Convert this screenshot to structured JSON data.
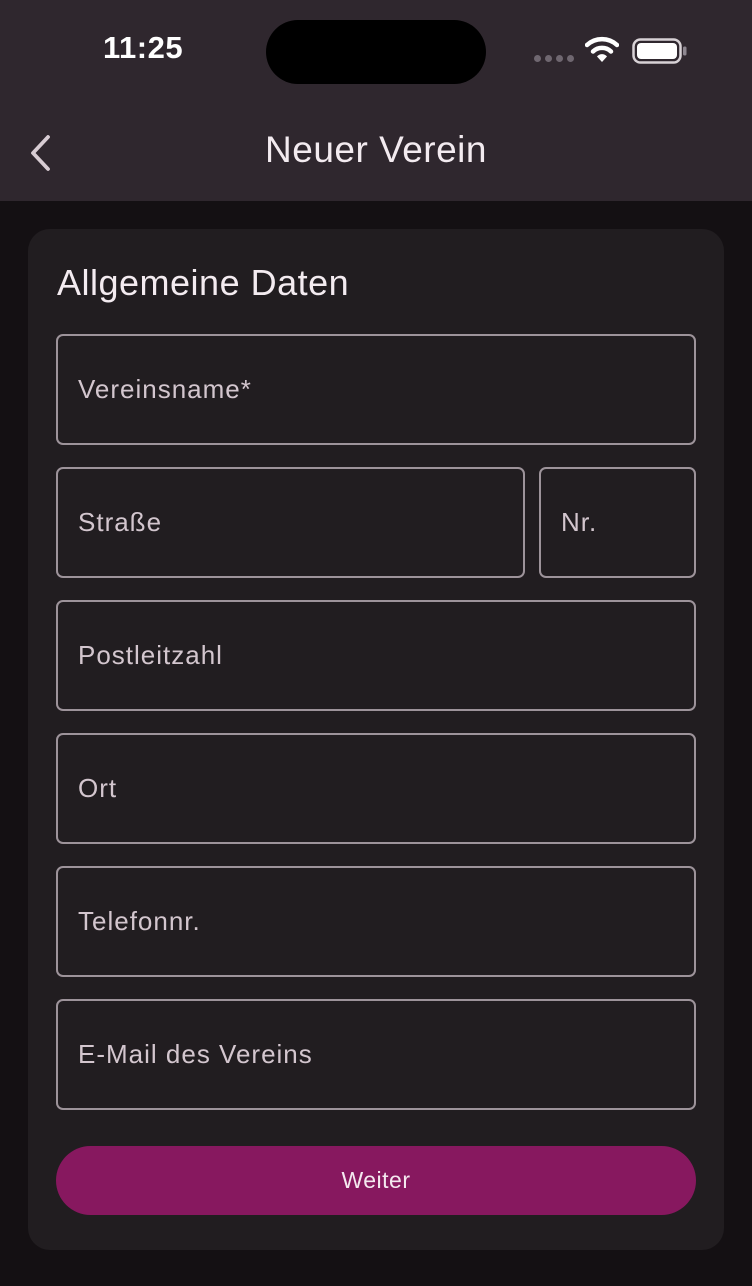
{
  "status_bar": {
    "time": "11:25"
  },
  "icons": {
    "back": "chevron-left-icon",
    "wifi": "wifi-icon",
    "battery": "battery-icon",
    "signal": "signal-dots-icon"
  },
  "header": {
    "title": "Neuer Verein"
  },
  "form": {
    "section_title": "Allgemeine Daten",
    "fields": {
      "club_name": {
        "placeholder": "Vereinsname*",
        "value": ""
      },
      "street": {
        "placeholder": "Straße",
        "value": ""
      },
      "house_number": {
        "placeholder": "Nr.",
        "value": ""
      },
      "postal_code": {
        "placeholder": "Postleitzahl",
        "value": ""
      },
      "city": {
        "placeholder": "Ort",
        "value": ""
      },
      "phone": {
        "placeholder": "Telefonnr.",
        "value": ""
      },
      "email": {
        "placeholder": "E-Mail des Vereins",
        "value": ""
      }
    },
    "submit_label": "Weiter"
  },
  "colors": {
    "accent": "#87185f",
    "app_bar": "#2f272e",
    "background": "#141013",
    "card": "#211d20",
    "field_border": "#9d939a"
  }
}
